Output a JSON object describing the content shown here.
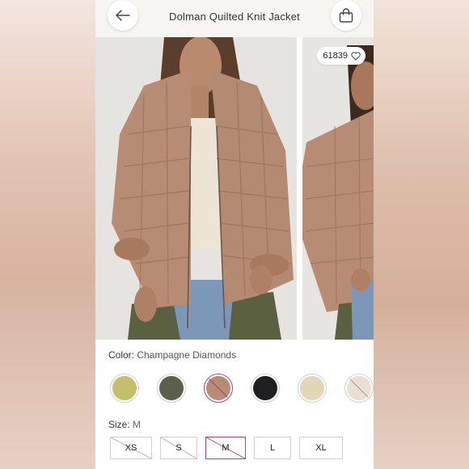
{
  "header": {
    "title": "Dolman Quilted Knit Jacket",
    "back_icon": "arrow-left-icon",
    "bag_icon": "shopping-bag-icon"
  },
  "gallery": {
    "likes": "61839",
    "heart_icon": "heart-outline-icon"
  },
  "color": {
    "label": "Color:",
    "selected": "Champagne Diamonds",
    "swatches": [
      {
        "name": "olive-green",
        "hex": "#c4c06a",
        "unavailable": false
      },
      {
        "name": "dark-olive",
        "hex": "#5b5f4c",
        "unavailable": false
      },
      {
        "name": "champagne",
        "hex": "#b58d73",
        "unavailable": true,
        "selected": true
      },
      {
        "name": "black",
        "hex": "#1f1f22",
        "unavailable": false
      },
      {
        "name": "cream",
        "hex": "#e3d6b8",
        "unavailable": false
      },
      {
        "name": "light-cream",
        "hex": "#e9e0d2",
        "unavailable": true
      }
    ]
  },
  "size": {
    "label": "Size:",
    "selected": "M",
    "options": [
      {
        "label": "XS",
        "unavailable": true
      },
      {
        "label": "S",
        "unavailable": true
      },
      {
        "label": "M",
        "unavailable": true,
        "selected": true
      },
      {
        "label": "L",
        "unavailable": false
      },
      {
        "label": "XL",
        "unavailable": false
      }
    ]
  },
  "colors": {
    "accent": "#b0437a",
    "header_bg": "#f7f5f2"
  }
}
